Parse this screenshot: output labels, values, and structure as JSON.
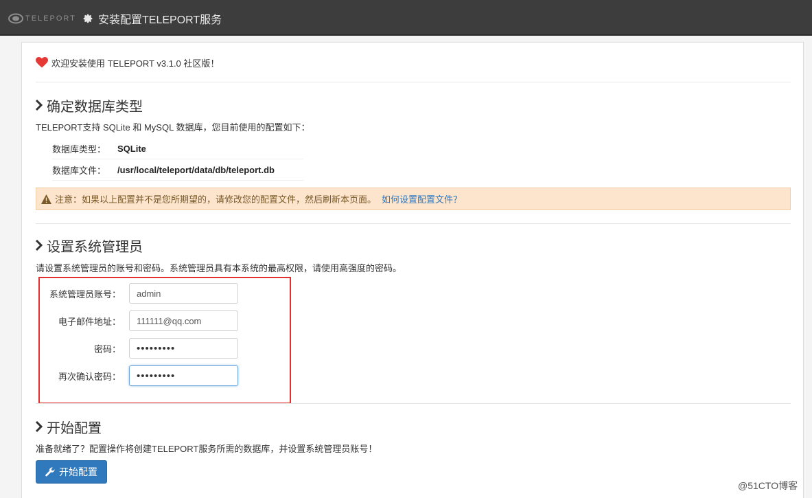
{
  "header": {
    "logo_text": "TELEPORT",
    "title": "安装配置TELEPORT服务"
  },
  "welcome": "欢迎安装使用 TELEPORT v3.1.0 社区版！",
  "db_section": {
    "title": "确定数据库类型",
    "desc": "TELEPORT支持 SQLite 和 MySQL 数据库，您目前使用的配置如下：",
    "rows": [
      {
        "label": "数据库类型：",
        "value": "SQLite"
      },
      {
        "label": "数据库文件：",
        "value": "/usr/local/teleport/data/db/teleport.db"
      }
    ],
    "notice_text": "注意：如果以上配置并不是您所期望的，请修改您的配置文件，然后刷新本页面。",
    "notice_link": "如何设置配置文件？"
  },
  "admin_section": {
    "title": "设置系统管理员",
    "desc": "请设置系统管理员的账号和密码。系统管理员具有本系统的最高权限，请使用高强度的密码。",
    "fields": {
      "account_label": "系统管理员账号：",
      "account_value": "admin",
      "email_label": "电子邮件地址：",
      "email_value": "111111@qq.com",
      "password_label": "密码：",
      "password_value": "123456789",
      "confirm_label": "再次确认密码：",
      "confirm_value": "123456789"
    }
  },
  "start_section": {
    "title": "开始配置",
    "desc": "准备就绪了？配置操作将创建TELEPORT服务所需的数据库，并设置系统管理员账号！",
    "button_label": "开始配置"
  },
  "watermark": "@51CTO博客",
  "colors": {
    "topbar": "#3d3d3d",
    "accent": "#3079bd",
    "alert_bg": "#fce5cc",
    "highlight_box": "#e23030",
    "heart": "#e53935"
  }
}
